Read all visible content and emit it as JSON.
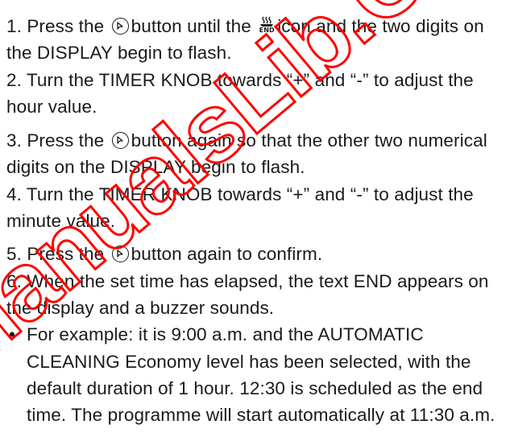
{
  "steps": {
    "s1": {
      "a": "1. Press the",
      "b": "button until the",
      "c": "icon and the two digits on the DISPLAY begin to flash."
    },
    "s2": {
      "text": "2. Turn the TIMER KNOB towards “+” and “-”  to adjust the hour value."
    },
    "s3": {
      "a": "3. Press the",
      "b": "button again so that the other two numerical digits on the DISPLAY begin to flash."
    },
    "s4": {
      "text": "4. Turn the TIMER KNOB towards “+” and “-”  to adjust the minute value."
    },
    "s5": {
      "a": "5. Press the",
      "b": "button again to confirm."
    },
    "s6": {
      "text": "6. When the set time has elapsed, the text END appears on the display and a buzzer sounds."
    }
  },
  "example": {
    "bullet": "•",
    "text": "For example: it is 9:00 a.m. and the AUTOMATIC CLEANING Economy level has been selected, with the default duration of 1 hour. 12:30 is scheduled as the end time. The programme will start automatically at 11:30 a.m."
  },
  "icons": {
    "button": "timer-button-icon",
    "end": "end-timer-icon",
    "end_label": "END"
  },
  "watermark": {
    "text": "ManualsLib.COM",
    "color": "#ff0000"
  }
}
